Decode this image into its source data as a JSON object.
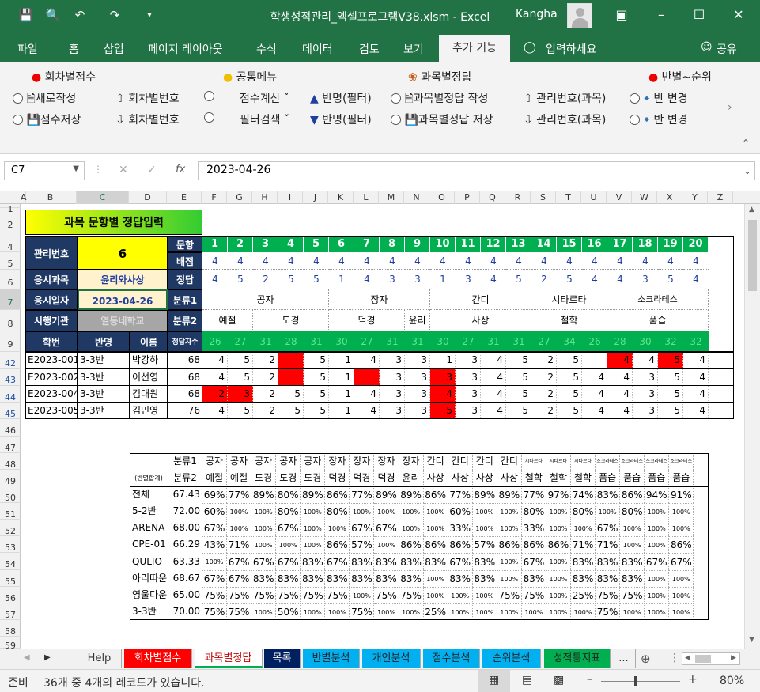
{
  "window": {
    "title": "학생성적관리_엑셀프로그램V38.xlsm  -  Excel",
    "user": "Kangha"
  },
  "ribbon_tabs": [
    "파일",
    "홈",
    "삽입",
    "페이지 레이아웃",
    "수식",
    "데이터",
    "검토",
    "보기",
    "추가 기능",
    "입력하세요",
    "공유"
  ],
  "ribbon": {
    "g1_title": "회차별점수",
    "g1_a": "새로작성",
    "g1_b": "회차별번호",
    "g1_c": "점수저장",
    "g1_d": "회차별번호",
    "g2_title": "공통메뉴",
    "g2_a": "점수계산",
    "g2_b": "반명(필터)",
    "g2_c": "필터검색",
    "g2_d": "반명(필터)",
    "g3_title": "과목별정답",
    "g3_a": "과목별정답 작성",
    "g3_b": "관리번호(과목)",
    "g3_c": "과목별정답 저장",
    "g3_d": "관리번호(과목)",
    "g4_title": "반별~순위",
    "g4_a": "반 변경",
    "g4_b": "반 변경"
  },
  "formula": {
    "cell": "C7",
    "fx": "fx",
    "value": "2023-04-26"
  },
  "columns": [
    "A",
    "B",
    "C",
    "D",
    "E",
    "F",
    "G",
    "H",
    "I",
    "J",
    "K",
    "L",
    "M",
    "N",
    "O",
    "P",
    "Q",
    "R",
    "S",
    "T",
    "U",
    "V",
    "W",
    "X",
    "Y",
    "Z"
  ],
  "rows": [
    "1",
    "2",
    "3",
    "4",
    "5",
    "6",
    "7",
    "8",
    "9",
    "42",
    "43",
    "44",
    "45",
    "46",
    "47",
    "48",
    "49",
    "50",
    "51",
    "52",
    "53",
    "54",
    "55",
    "56",
    "57",
    "58",
    "59"
  ],
  "sheet": {
    "title": "과목 문항별 정답입력",
    "labels": {
      "mgmt": "관리번호",
      "subject": "응시과목",
      "date": "응시일자",
      "org": "시행기관",
      "q": "문항",
      "pts": "배점",
      "ans": "정답",
      "c1": "분류1",
      "c2": "분류2",
      "sid": "학번",
      "cls": "반명",
      "name": "이름",
      "cnt": "정답자수"
    },
    "values": {
      "mgmt": "6",
      "subject": "윤리와사상",
      "date": "2023-04-26",
      "org": "열동네학교"
    },
    "questions": [
      "1",
      "2",
      "3",
      "4",
      "5",
      "6",
      "7",
      "8",
      "9",
      "10",
      "11",
      "12",
      "13",
      "14",
      "15",
      "16",
      "17",
      "18",
      "19",
      "20"
    ],
    "points": [
      "4",
      "4",
      "4",
      "4",
      "4",
      "4",
      "4",
      "4",
      "4",
      "4",
      "4",
      "4",
      "4",
      "4",
      "4",
      "4",
      "4",
      "4",
      "4",
      "4"
    ],
    "answers": [
      "4",
      "5",
      "2",
      "5",
      "5",
      "1",
      "4",
      "3",
      "3",
      "1",
      "3",
      "4",
      "5",
      "2",
      "5",
      "4",
      "4",
      "3",
      "5",
      "4"
    ],
    "cat1": [
      {
        "label": "공자",
        "span": 5
      },
      {
        "label": "장자",
        "span": 4
      },
      {
        "label": "간디",
        "span": 4
      },
      {
        "label": "시타르타",
        "span": 3
      },
      {
        "label": "소크라테스",
        "span": 4
      }
    ],
    "cat2": [
      {
        "label": "예절",
        "span": 2
      },
      {
        "label": "도경",
        "span": 3
      },
      {
        "label": "덕경",
        "span": 3
      },
      {
        "label": "윤리",
        "span": 1
      },
      {
        "label": "사상",
        "span": 4
      },
      {
        "label": "철학",
        "span": 3
      },
      {
        "label": "품습",
        "span": 4
      }
    ],
    "correct_counts": [
      "26",
      "27",
      "31",
      "28",
      "31",
      "30",
      "27",
      "31",
      "31",
      "30",
      "27",
      "31",
      "31",
      "27",
      "34",
      "26",
      "28",
      "30",
      "32",
      "32"
    ],
    "students": [
      {
        "id": "E2023-001",
        "cls": "3-3반",
        "name": "박강하",
        "score": "68",
        "ans": [
          "4",
          "5",
          "2",
          "",
          "5",
          "1",
          "4",
          "3",
          "3",
          "1",
          "3",
          "4",
          "5",
          "2",
          "5",
          "",
          "4",
          "4",
          "5",
          "4"
        ],
        "wrong": [
          3,
          16,
          18
        ]
      },
      {
        "id": "E2023-002",
        "cls": "3-3반",
        "name": "이선영",
        "score": "68",
        "ans": [
          "4",
          "5",
          "2",
          "",
          "5",
          "1",
          "",
          "3",
          "3",
          "3",
          "3",
          "4",
          "5",
          "2",
          "5",
          "4",
          "4",
          "3",
          "5",
          "4"
        ],
        "wrong": [
          3,
          6,
          9
        ]
      },
      {
        "id": "E2023-004",
        "cls": "3-3반",
        "name": "김대원",
        "score": "68",
        "ans": [
          "2",
          "3",
          "2",
          "5",
          "5",
          "1",
          "4",
          "3",
          "3",
          "4",
          "3",
          "4",
          "5",
          "2",
          "5",
          "4",
          "4",
          "3",
          "5",
          "4"
        ],
        "wrong": [
          0,
          1,
          9
        ]
      },
      {
        "id": "E2023-005",
        "cls": "3-3반",
        "name": "김민영",
        "score": "76",
        "ans": [
          "4",
          "5",
          "2",
          "5",
          "5",
          "1",
          "4",
          "3",
          "3",
          "5",
          "3",
          "4",
          "5",
          "2",
          "5",
          "4",
          "4",
          "3",
          "5",
          "4"
        ],
        "wrong": [
          9
        ]
      }
    ],
    "summary": {
      "hdr1_label": "분류1",
      "hdr2_label": "분류2",
      "corner": "(반별합계)",
      "cat1": [
        "공자",
        "공자",
        "공자",
        "공자",
        "공자",
        "장자",
        "장자",
        "장자",
        "장자",
        "간디",
        "간디",
        "간디",
        "간디",
        "시타르타",
        "시타르타",
        "시타르타",
        "소크라테스",
        "소크라테스",
        "소크라테스",
        "소크라테스"
      ],
      "cat2": [
        "예절",
        "예절",
        "도경",
        "도경",
        "도경",
        "덕경",
        "덕경",
        "덕경",
        "윤리",
        "사상",
        "사상",
        "사상",
        "사상",
        "철학",
        "철학",
        "철학",
        "품습",
        "품습",
        "품습",
        "품습"
      ],
      "rows": [
        {
          "name": "전체",
          "avg": "67.43",
          "vals": [
            "69%",
            "77%",
            "89%",
            "80%",
            "89%",
            "86%",
            "77%",
            "89%",
            "89%",
            "86%",
            "77%",
            "89%",
            "89%",
            "77%",
            "97%",
            "74%",
            "83%",
            "86%",
            "94%",
            "91%"
          ]
        },
        {
          "name": "5-2반",
          "avg": "72.00",
          "vals": [
            "60%",
            "100%",
            "100%",
            "80%",
            "100%",
            "80%",
            "100%",
            "100%",
            "100%",
            "100%",
            "60%",
            "100%",
            "100%",
            "80%",
            "100%",
            "80%",
            "100%",
            "80%",
            "100%",
            "100%"
          ]
        },
        {
          "name": "ARENA",
          "avg": "68.00",
          "vals": [
            "67%",
            "100%",
            "100%",
            "67%",
            "100%",
            "100%",
            "67%",
            "67%",
            "100%",
            "100%",
            "33%",
            "100%",
            "100%",
            "33%",
            "100%",
            "100%",
            "67%",
            "100%",
            "100%",
            "100%"
          ]
        },
        {
          "name": "CPE-01",
          "avg": "66.29",
          "vals": [
            "43%",
            "71%",
            "100%",
            "100%",
            "100%",
            "86%",
            "57%",
            "100%",
            "86%",
            "86%",
            "86%",
            "57%",
            "86%",
            "86%",
            "86%",
            "71%",
            "71%",
            "100%",
            "100%",
            "86%"
          ]
        },
        {
          "name": "QULIO",
          "avg": "63.33",
          "vals": [
            "100%",
            "67%",
            "67%",
            "67%",
            "83%",
            "67%",
            "83%",
            "83%",
            "83%",
            "83%",
            "67%",
            "83%",
            "100%",
            "67%",
            "100%",
            "83%",
            "83%",
            "83%",
            "67%",
            "67%"
          ]
        },
        {
          "name": "아리따운",
          "avg": "68.67",
          "vals": [
            "67%",
            "67%",
            "83%",
            "83%",
            "83%",
            "83%",
            "83%",
            "83%",
            "83%",
            "100%",
            "83%",
            "83%",
            "100%",
            "83%",
            "100%",
            "83%",
            "83%",
            "83%",
            "100%",
            "100%"
          ]
        },
        {
          "name": "영울다운",
          "avg": "65.00",
          "vals": [
            "75%",
            "75%",
            "75%",
            "75%",
            "75%",
            "75%",
            "100%",
            "75%",
            "75%",
            "100%",
            "100%",
            "100%",
            "75%",
            "75%",
            "100%",
            "25%",
            "75%",
            "75%",
            "100%",
            "100%"
          ]
        },
        {
          "name": "3-3반",
          "avg": "70.00",
          "vals": [
            "75%",
            "75%",
            "100%",
            "50%",
            "100%",
            "100%",
            "75%",
            "100%",
            "100%",
            "25%",
            "100%",
            "100%",
            "100%",
            "100%",
            "100%",
            "100%",
            "75%",
            "100%",
            "100%",
            "100%"
          ]
        }
      ]
    }
  },
  "sheet_tabs": [
    {
      "label": "Help",
      "bg": "#f1f1f1",
      "fg": "#333"
    },
    {
      "label": "회차별점수",
      "bg": "#ff0000",
      "fg": "#ffffff"
    },
    {
      "label": "과목별정답",
      "bg": "#ffffff",
      "fg": "#c00000"
    },
    {
      "label": "목록",
      "bg": "#002060",
      "fg": "#ffffff"
    },
    {
      "label": "반별분석",
      "bg": "#00b0f0",
      "fg": "#222"
    },
    {
      "label": "개인분석",
      "bg": "#00b0f0",
      "fg": "#222"
    },
    {
      "label": "점수분석",
      "bg": "#00b0f0",
      "fg": "#222"
    },
    {
      "label": "순위분석",
      "bg": "#00b0f0",
      "fg": "#222"
    },
    {
      "label": "성적통지표",
      "bg": "#00b050",
      "fg": "#222"
    },
    {
      "label": "...",
      "bg": "#f1f1f1",
      "fg": "#333"
    }
  ],
  "status": {
    "ready": "준비",
    "records": "36개 중 4개의 레코드가 있습니다.",
    "zoom": "80%"
  }
}
